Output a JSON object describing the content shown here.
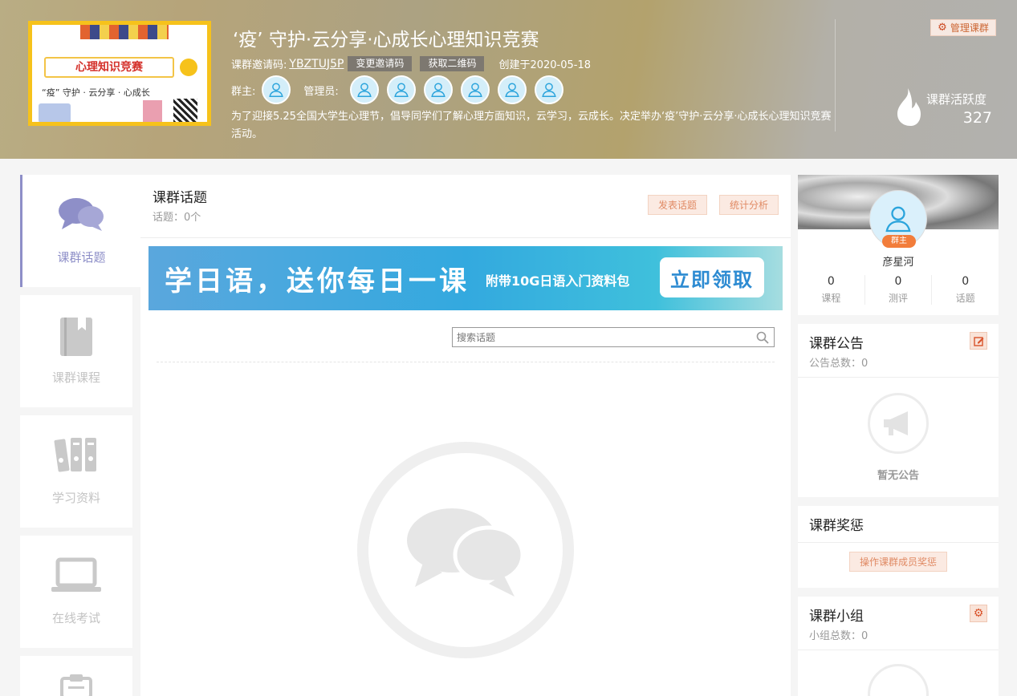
{
  "header": {
    "title": "‘疫’ 守护·云分享·心成长心理知识竞赛",
    "invite_label": "课群邀请码:",
    "invite_code": "YBZTUJ5P",
    "change_code": "变更邀请码",
    "get_qr": "获取二维码",
    "created": "创建于2020-05-18",
    "owner_label": "群主:",
    "admin_label": "管理员:",
    "description": "为了迎接5.25全国大学生心理节，倡导同学们了解心理方面知识，云学习，云成长。决定举办‘疫’守护·云分享·心成长心理知识竞赛活动。",
    "manage": "管理课群",
    "activity_label": "课群活跃度",
    "activity_value": "327",
    "cover": {
      "title": "心理知识竞赛",
      "subtitle": "“疫” 守护 · 云分享 · 心成长"
    }
  },
  "left_nav": [
    {
      "label": "课群话题",
      "icon": "chat-bubbles-icon",
      "active": true
    },
    {
      "label": "课群课程",
      "icon": "book-icon",
      "active": false
    },
    {
      "label": "学习资料",
      "icon": "binders-icon",
      "active": false
    },
    {
      "label": "在线考试",
      "icon": "laptop-icon",
      "active": false
    },
    {
      "label": "",
      "icon": "clipboard-icon",
      "active": false
    }
  ],
  "main": {
    "title": "课群话题",
    "count": "话题：0个",
    "post_button": "发表话题",
    "stats_button": "统计分析",
    "banner": {
      "headline": "学日语，送你每日一课",
      "sub": "附带10G日语入门资料包",
      "cta": "立即领取"
    },
    "search_placeholder": "搜索话题"
  },
  "profile": {
    "badge": "群主",
    "name": "彦星河",
    "stats": [
      {
        "value": "0",
        "label": "课程"
      },
      {
        "value": "0",
        "label": "测评"
      },
      {
        "value": "0",
        "label": "话题"
      }
    ]
  },
  "announcement": {
    "title": "课群公告",
    "count": "公告总数：0",
    "empty": "暂无公告"
  },
  "rewards": {
    "title": "课群奖惩",
    "button": "操作课群成员奖惩"
  },
  "groups": {
    "title": "课群小组",
    "count": "小组总数：0"
  },
  "colors": {
    "accent_purple": "#8e8fc8",
    "accent_orange": "#e08a64",
    "badge_orange": "#f27d3b"
  }
}
